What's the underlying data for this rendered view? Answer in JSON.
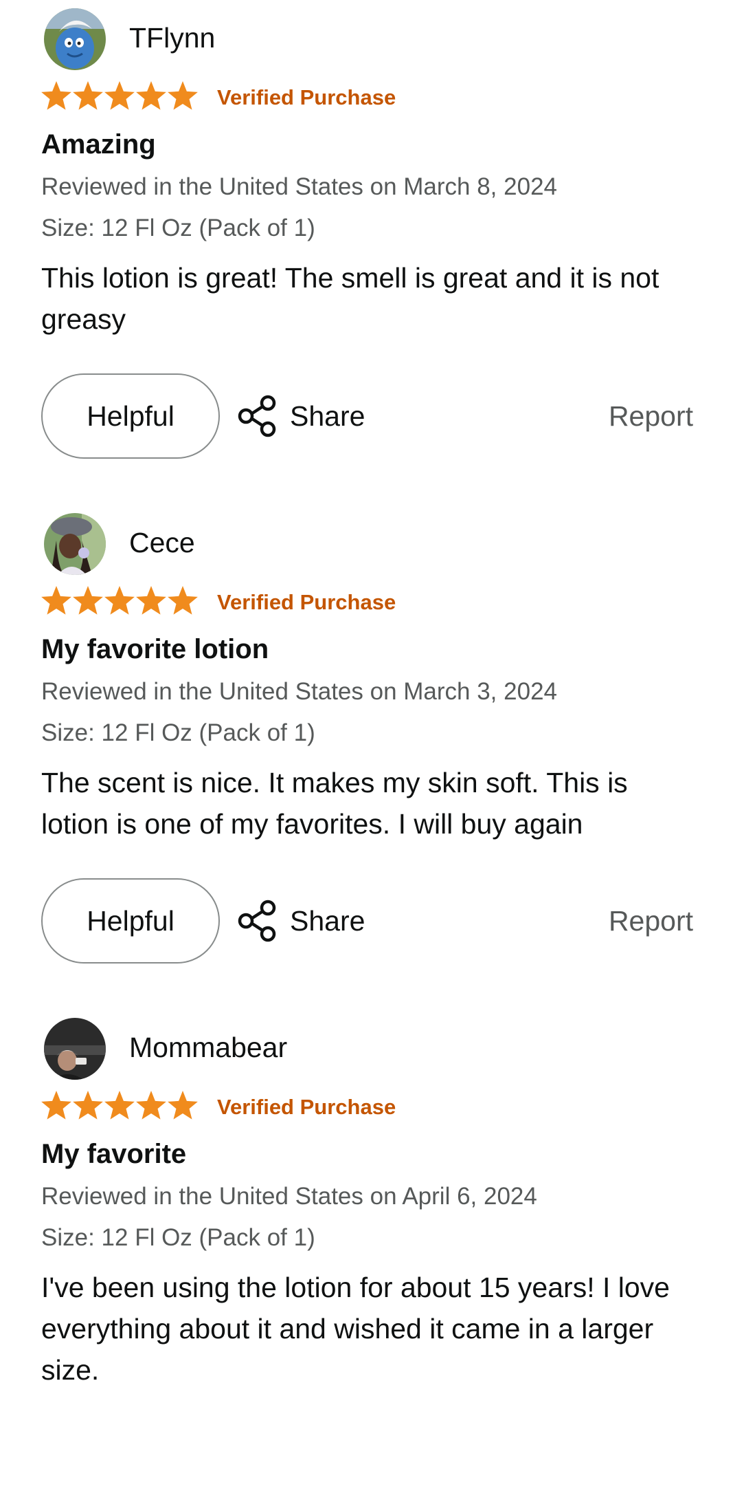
{
  "colors": {
    "star": "#f08b1d",
    "verified": "#c45500",
    "text": "#0f1111",
    "secondary": "#565959",
    "border": "#888c8c"
  },
  "icons": {
    "star": "star-icon",
    "share": "share-icon"
  },
  "reviews": [
    {
      "author": "TFlynn",
      "rating": 5,
      "verified_label": "Verified Purchase",
      "title": "Amazing",
      "date_line": "Reviewed in the United States on March 8, 2024",
      "size_line": "Size: 12 Fl Oz (Pack of 1)",
      "body": "This lotion is great! The smell is great and it is not greasy",
      "helpful_label": "Helpful",
      "share_label": "Share",
      "report_label": "Report"
    },
    {
      "author": "Cece",
      "rating": 5,
      "verified_label": "Verified Purchase",
      "title": "My favorite lotion",
      "date_line": "Reviewed in the United States on March 3, 2024",
      "size_line": "Size: 12 Fl Oz (Pack of 1)",
      "body": "The scent is nice. It makes my skin soft. This is lotion is one of my favorites. I will buy again",
      "helpful_label": "Helpful",
      "share_label": "Share",
      "report_label": "Report"
    },
    {
      "author": "Mommabear",
      "rating": 5,
      "verified_label": "Verified Purchase",
      "title": "My favorite",
      "date_line": "Reviewed in the United States on April 6, 2024",
      "size_line": "Size: 12 Fl Oz (Pack of 1)",
      "body": "I've been using the lotion for about 15 years! I love everything about it and wished it came in a larger size."
    }
  ]
}
